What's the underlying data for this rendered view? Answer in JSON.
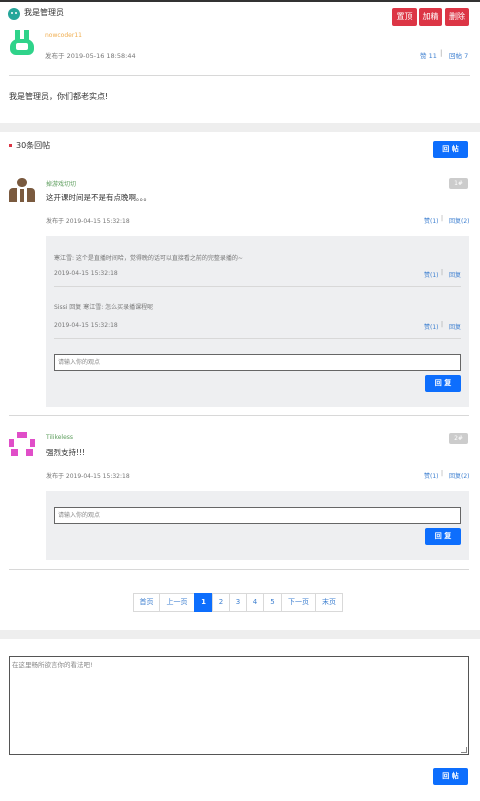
{
  "header": {
    "title": "我是管理员",
    "actions": {
      "top": "置顶",
      "highlight": "加精",
      "delete": "删除"
    }
  },
  "post": {
    "author": "nowcoder11",
    "time": "发布于 2019-05-16 18:58:44",
    "like": "赞 11",
    "reply": "回帖 7",
    "content": "我是管理员，你们都老实点!"
  },
  "replies_section": {
    "count": "30条回帖",
    "reply_button": "回 帖"
  },
  "comments": [
    {
      "author": "掉游戏切切",
      "text": "这开课时间是不是有点晚啊。。。",
      "floor": "1#",
      "time": "发布于 2019-04-15 15:32:18",
      "like": "赞(1)",
      "reply": "回复(2)",
      "sub": [
        {
          "text": "寒江雪: 这个是直播时间哈，觉得晚的话可以直接看之前的完整录播的~",
          "time": "2019-04-15 15:32:18",
          "like": "赞(1)",
          "reply": "回复"
        },
        {
          "text": "Sissi 回复 寒江雪: 怎么买录播课程呢",
          "time": "2019-04-15 15:32:18",
          "like": "赞(1)",
          "reply": "回复"
        }
      ],
      "input_placeholder": "请输入你的观点",
      "reply_button": "回 复"
    },
    {
      "author": "Tilikeless",
      "text": "强烈支持!!!",
      "floor": "2#",
      "time": "发布于 2019-04-15 15:32:18",
      "like": "赞(1)",
      "reply": "回复(2)",
      "input_placeholder": "请输入你的观点",
      "reply_button": "回 复"
    }
  ],
  "pagination": {
    "items": [
      "首页",
      "上一页",
      "1",
      "2",
      "3",
      "4",
      "5",
      "下一页",
      "末页"
    ],
    "current": "1"
  },
  "editor": {
    "placeholder": "在这里畅所欲言你的看法吧!",
    "submit": "回 帖"
  },
  "colors": {
    "accent": "#0d6efd",
    "danger": "#dc3545",
    "author": "#f0ad4e",
    "green": "#5a9c5a"
  }
}
